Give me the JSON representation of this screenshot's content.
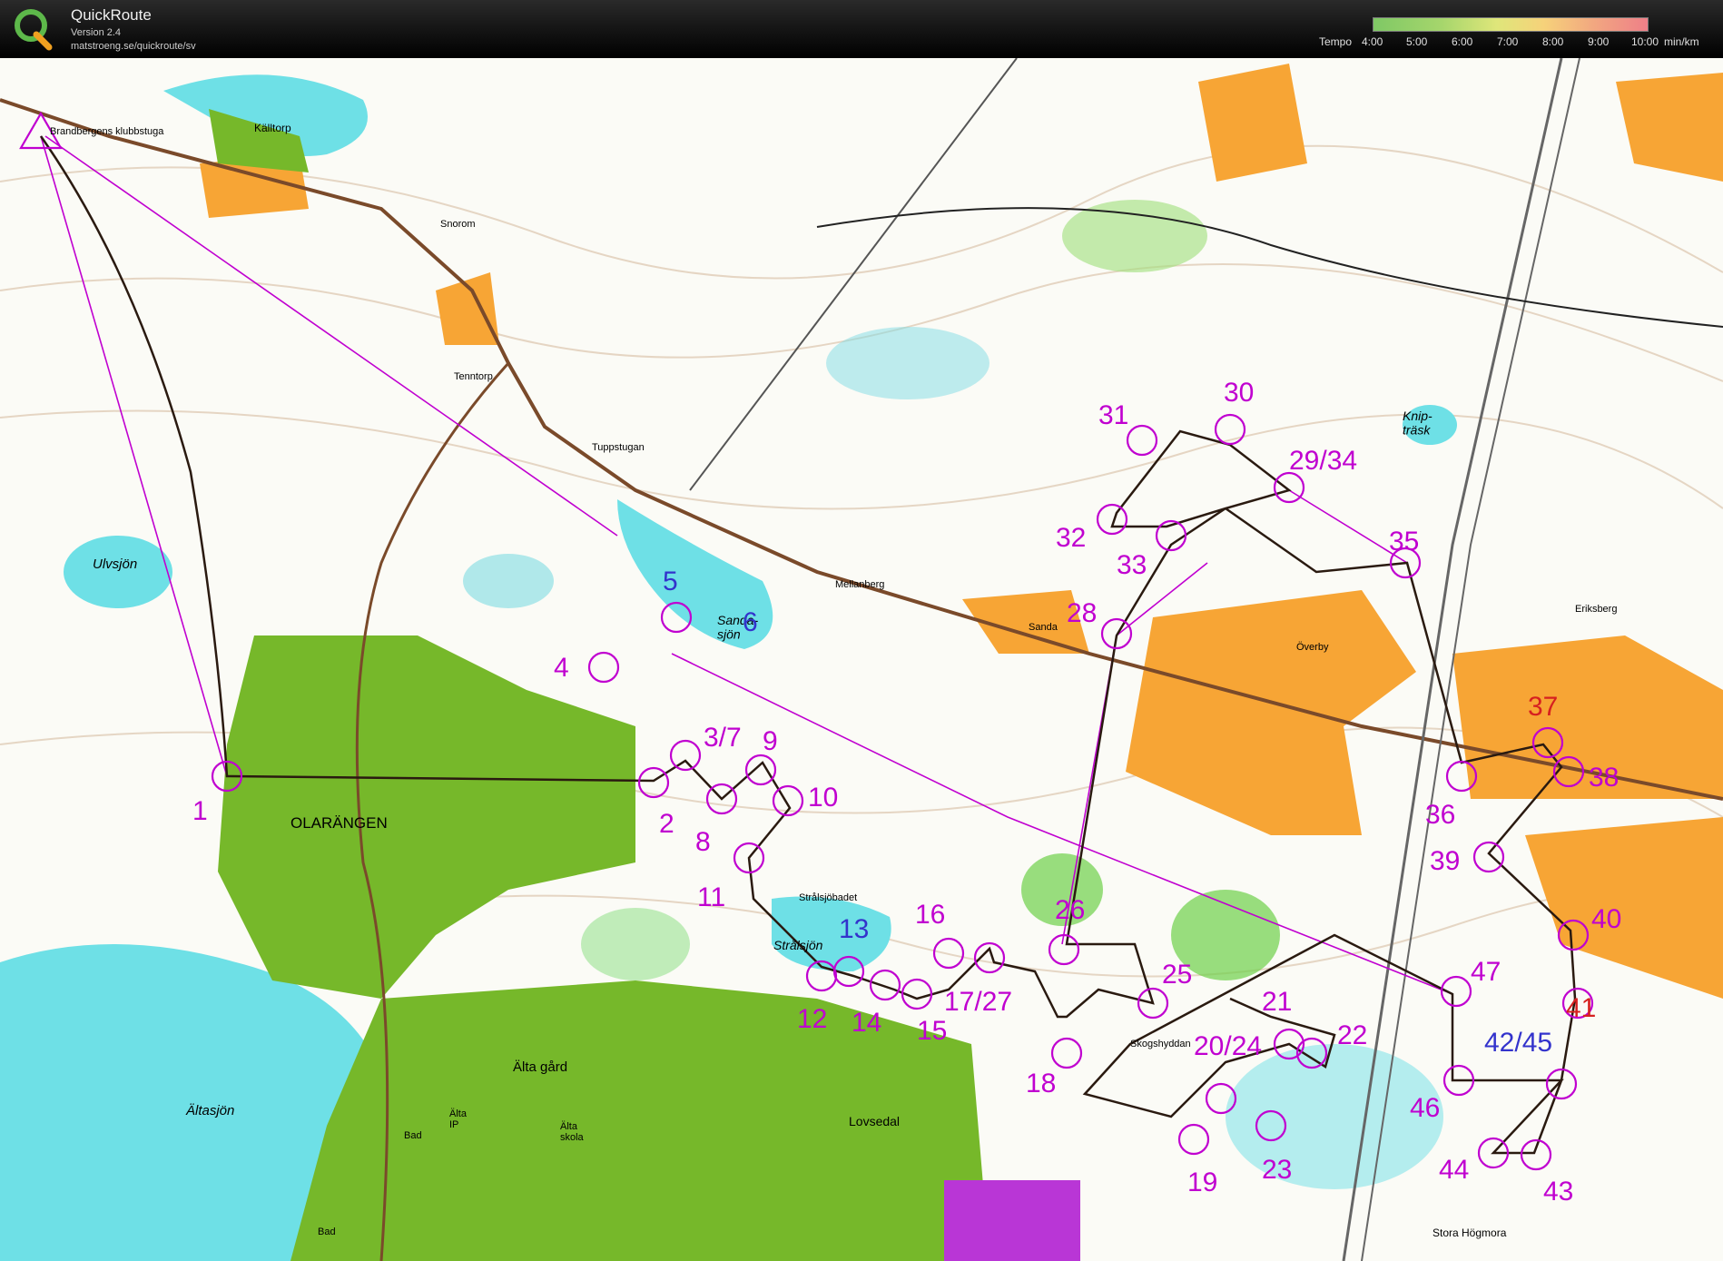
{
  "app": {
    "title": "QuickRoute",
    "version": "Version 2.4",
    "url": "matstroeng.se/quickroute/sv"
  },
  "legend": {
    "tempo_label": "Tempo",
    "ticks": [
      "4:00",
      "5:00",
      "6:00",
      "7:00",
      "8:00",
      "9:00",
      "10:00"
    ],
    "unit": "min/km",
    "gradient_colors": [
      "#7fc865",
      "#dfe67a",
      "#f2a880",
      "#ee7f88"
    ]
  },
  "map": {
    "place_names": {
      "klubbstuga": "Brandbergens klubbstuga",
      "kalltorp": "Källtorp",
      "snorom": "Snorom",
      "tenntorp": "Tenntorp",
      "tuppstugan": "Tuppstugan",
      "ulvsjon": "Ulvsjön",
      "sandasjon": "Sanda-\nsjön",
      "mellanberg": "Mellanberg",
      "sanda": "Sanda",
      "overby": "Överby",
      "knipträsk": "Knip-\nträsk",
      "eriksberg": "Eriksberg",
      "olarangen": "OLARÄNGEN",
      "stralsjobadet": "Strålsjöbadet",
      "stralsjon": "Strålsjön",
      "skogshyddan": "Skogshyddan",
      "altasjon": "Ältasjön",
      "alta_gard": "Älta gård",
      "lovsedal": "Lovsedal",
      "alta_ip": "Älta\nIP",
      "alta_skola": "Älta\nskola",
      "bad1": "Bad",
      "bad2": "Bad",
      "stora_hogmora": "Stora Högmora"
    },
    "control_numbers": [
      "1",
      "2",
      "3/7",
      "4",
      "5",
      "6",
      "8",
      "9",
      "10",
      "11",
      "12",
      "13",
      "14",
      "15",
      "16",
      "17/27",
      "18",
      "19",
      "20/24",
      "21",
      "22",
      "23",
      "25",
      "26",
      "28",
      "29/34",
      "30",
      "31",
      "32",
      "33",
      "35",
      "36",
      "37",
      "38",
      "39",
      "40",
      "41",
      "42/45",
      "43",
      "44",
      "46",
      "47"
    ],
    "colors": {
      "water": "#6ee0e6",
      "forest_open": "#ffffff",
      "green_urban": "#76b82a",
      "field": "#f7a535",
      "control": "#c000d0",
      "route": "#000000"
    }
  }
}
